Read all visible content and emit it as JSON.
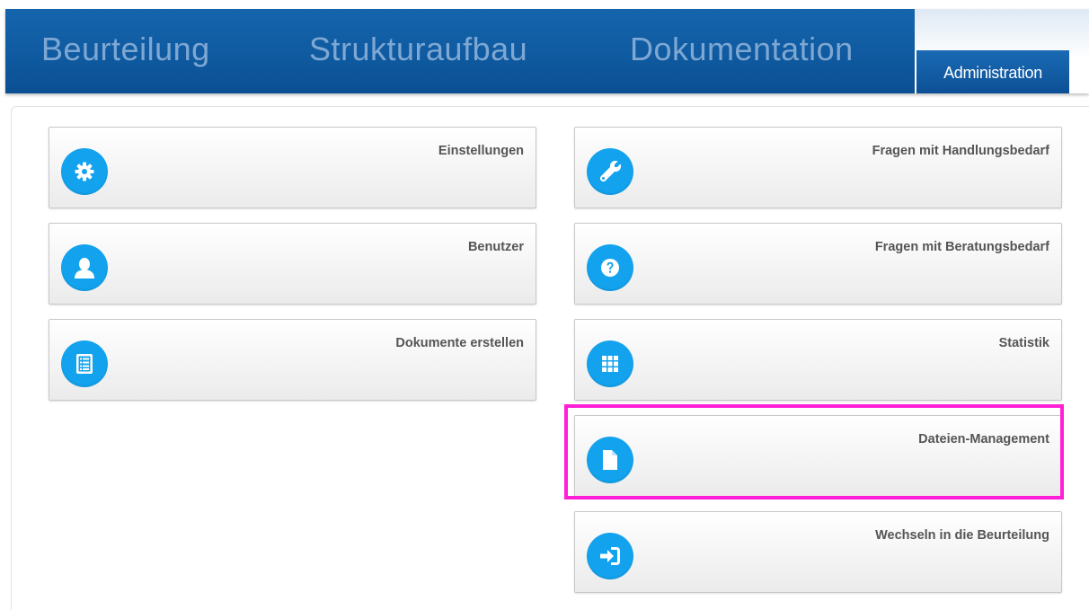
{
  "nav": {
    "tabs": [
      {
        "label": "Beurteilung"
      },
      {
        "label": "Strukturaufbau"
      },
      {
        "label": "Dokumentation"
      }
    ],
    "active_tab": {
      "label": "Administration"
    }
  },
  "tiles": {
    "left": [
      {
        "label": "Einstellungen",
        "icon": "gear-icon"
      },
      {
        "label": "Benutzer",
        "icon": "user-icon"
      },
      {
        "label": "Dokumente erstellen",
        "icon": "document-list-icon"
      }
    ],
    "right": [
      {
        "label": "Fragen mit Handlungsbedarf",
        "icon": "wrench-icon"
      },
      {
        "label": "Fragen mit Beratungsbedarf",
        "icon": "question-icon"
      },
      {
        "label": "Statistik",
        "icon": "grid-icon"
      },
      {
        "label": "Dateien-Management",
        "icon": "file-icon"
      },
      {
        "label": "Wechseln in die Beurteilung",
        "icon": "sign-in-icon"
      }
    ]
  },
  "colors": {
    "nav_bar": "#0f5aa0",
    "nav_tab_text": "#7ea8d3",
    "icon_circle": "#13a3ee",
    "highlight": "#ff1fd6"
  }
}
